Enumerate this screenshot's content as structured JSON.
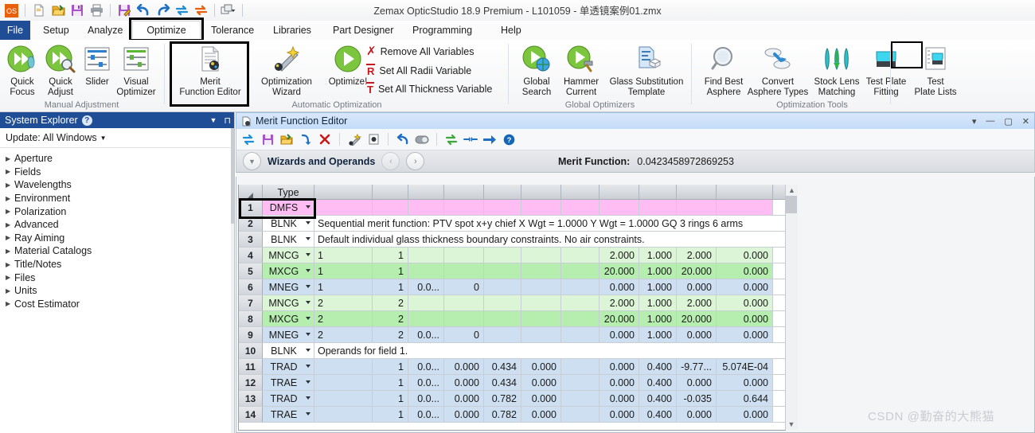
{
  "titlebar": {
    "app_title": "Zemax OpticStudio 18.9     Premium - L101059 - 单透镜案例01.zmx",
    "quick_access": [
      {
        "name": "os-logo-icon",
        "label": "OS"
      },
      {
        "name": "new-file-icon",
        "label": "New"
      },
      {
        "name": "open-file-icon",
        "label": "Open"
      },
      {
        "name": "save-icon",
        "label": "Save"
      },
      {
        "name": "print-icon",
        "label": "Print"
      },
      {
        "name": "save-as-icon",
        "label": "Save As"
      },
      {
        "name": "undo-icon",
        "label": "Undo"
      },
      {
        "name": "redo-icon",
        "label": "Redo"
      },
      {
        "name": "update-icon",
        "label": "Update"
      },
      {
        "name": "update-all-icon",
        "label": "Update All"
      },
      {
        "name": "window-arrange-icon",
        "label": "Windows"
      }
    ]
  },
  "menubar": {
    "items": [
      {
        "label": "File",
        "active": false,
        "highlighted": false
      },
      {
        "label": "Setup",
        "active": false,
        "highlighted": false
      },
      {
        "label": "Analyze",
        "active": false,
        "highlighted": false
      },
      {
        "label": "Optimize",
        "active": true,
        "highlighted": true
      },
      {
        "label": "Tolerance",
        "active": false,
        "highlighted": false
      },
      {
        "label": "Libraries",
        "active": false,
        "highlighted": false
      },
      {
        "label": "Part Designer",
        "active": false,
        "highlighted": false
      },
      {
        "label": "Programming",
        "active": false,
        "highlighted": false
      },
      {
        "label": "Help",
        "active": false,
        "highlighted": false
      }
    ]
  },
  "ribbon": {
    "groups": [
      {
        "caption": "Manual Adjustment"
      },
      {
        "caption": "Automatic Optimization"
      },
      {
        "caption": "Global Optimizers"
      },
      {
        "caption": "Optimization Tools"
      }
    ],
    "buttons": {
      "quick_focus": "Quick\nFocus",
      "quick_focus_l1": "Quick",
      "quick_focus_l2": "Focus",
      "quick_adjust_l1": "Quick",
      "quick_adjust_l2": "Adjust",
      "slider": "Slider",
      "visual_opt_l1": "Visual",
      "visual_opt_l2": "Optimizer",
      "merit_fn_l1": "Merit",
      "merit_fn_l2": "Function Editor",
      "opt_wizard_l1": "Optimization",
      "opt_wizard_l2": "Wizard",
      "optimize": "Optimize!",
      "global_search_l1": "Global",
      "global_search_l2": "Search",
      "hammer_l1": "Hammer",
      "hammer_l2": "Current",
      "glass_sub_l1": "Glass Substitution",
      "glass_sub_l2": "Template",
      "find_best_l1": "Find Best",
      "find_best_l2": "Asphere",
      "convert_l1": "Convert",
      "convert_l2": "Asphere Types",
      "stock_lens_l1": "Stock Lens",
      "stock_lens_l2": "Matching",
      "test_plate_fit_l1": "Test Plate",
      "test_plate_fit_l2": "Fitting",
      "test_plate_lists_l1": "Test",
      "test_plate_lists_l2": "Plate Lists"
    },
    "small_commands": [
      {
        "label": "Remove All Variables",
        "glyph": "X",
        "color": "#c8181c"
      },
      {
        "label": "Set All Radii Variable",
        "glyph": "R",
        "color": "#c8181c"
      },
      {
        "label": "Set All Thickness Variable",
        "glyph": "T",
        "color": "#c8181c"
      }
    ]
  },
  "system_explorer": {
    "title": "System Explorer",
    "help_icon": "?",
    "update_label": "Update: All Windows",
    "items": [
      {
        "label": "Aperture"
      },
      {
        "label": "Fields"
      },
      {
        "label": "Wavelengths"
      },
      {
        "label": "Environment"
      },
      {
        "label": "Polarization"
      },
      {
        "label": "Advanced"
      },
      {
        "label": "Ray Aiming"
      },
      {
        "label": "Material Catalogs"
      },
      {
        "label": "Title/Notes"
      },
      {
        "label": "Files"
      },
      {
        "label": "Units"
      },
      {
        "label": "Cost Estimator"
      }
    ]
  },
  "mfe": {
    "window_title": "Merit Function Editor",
    "window_controls": [
      "▾",
      "—",
      "▢",
      "✕"
    ],
    "toolbar_icons": [
      {
        "name": "refresh-icon"
      },
      {
        "name": "save-icon"
      },
      {
        "name": "open-icon"
      },
      {
        "name": "insert-icon"
      },
      {
        "name": "delete-icon"
      },
      {
        "name": "wizard-icon"
      },
      {
        "name": "properties-icon"
      },
      {
        "name": "undo-icon"
      },
      {
        "name": "toggle-icon"
      },
      {
        "name": "sync-icon"
      },
      {
        "name": "collapse-icon"
      },
      {
        "name": "next-icon"
      },
      {
        "name": "help-icon"
      }
    ],
    "wizard_bar": {
      "title": "Wizards and Operands",
      "prev": "‹",
      "next": "›",
      "merit_label": "Merit Function:",
      "merit_value": "0.0423458972869253"
    },
    "grid": {
      "header_type": "Type",
      "columns": [
        "",
        "Type",
        "",
        "",
        "",
        "",
        "",
        "",
        "",
        "",
        "",
        "",
        "",
        ""
      ],
      "rows": [
        {
          "n": "1",
          "type": "DMFS",
          "color": "pink",
          "selected": true,
          "comment": "",
          "cells": []
        },
        {
          "n": "2",
          "type": "BLNK",
          "color": "white",
          "comment": "Sequential merit function: PTV spot x+y chief X Wgt = 1.0000 Y Wgt = 1.0000 GQ 3 rings 6 arms",
          "cells": []
        },
        {
          "n": "3",
          "type": "BLNK",
          "color": "white",
          "comment": "Default individual glass thickness boundary constraints. No air constraints.",
          "cells": []
        },
        {
          "n": "4",
          "type": "MNCG",
          "color": "green-light",
          "comment": "",
          "cells": [
            "1",
            "1",
            "",
            "",
            "",
            "",
            "",
            "2.000",
            "1.000",
            "2.000",
            "0.000"
          ]
        },
        {
          "n": "5",
          "type": "MXCG",
          "color": "green",
          "comment": "",
          "cells": [
            "1",
            "1",
            "",
            "",
            "",
            "",
            "",
            "20.000",
            "1.000",
            "20.000",
            "0.000"
          ]
        },
        {
          "n": "6",
          "type": "MNEG",
          "color": "blue",
          "comment": "",
          "cells": [
            "1",
            "1",
            "0.0...",
            "0",
            "",
            "",
            "",
            "0.000",
            "1.000",
            "0.000",
            "0.000"
          ]
        },
        {
          "n": "7",
          "type": "MNCG",
          "color": "green-light",
          "comment": "",
          "cells": [
            "2",
            "2",
            "",
            "",
            "",
            "",
            "",
            "2.000",
            "1.000",
            "2.000",
            "0.000"
          ]
        },
        {
          "n": "8",
          "type": "MXCG",
          "color": "green",
          "comment": "",
          "cells": [
            "2",
            "2",
            "",
            "",
            "",
            "",
            "",
            "20.000",
            "1.000",
            "20.000",
            "0.000"
          ]
        },
        {
          "n": "9",
          "type": "MNEG",
          "color": "blue",
          "comment": "",
          "cells": [
            "2",
            "2",
            "0.0...",
            "0",
            "",
            "",
            "",
            "0.000",
            "1.000",
            "0.000",
            "0.000"
          ]
        },
        {
          "n": "10",
          "type": "BLNK",
          "color": "white",
          "comment": "Operands for field 1.",
          "cells": []
        },
        {
          "n": "11",
          "type": "TRAD",
          "color": "blue",
          "comment": "",
          "cells": [
            "",
            "1",
            "0.0...",
            "0.000",
            "0.434",
            "0.000",
            "",
            "0.000",
            "0.400",
            "-9.77...",
            "5.074E-04"
          ]
        },
        {
          "n": "12",
          "type": "TRAE",
          "color": "blue",
          "comment": "",
          "cells": [
            "",
            "1",
            "0.0...",
            "0.000",
            "0.434",
            "0.000",
            "",
            "0.000",
            "0.400",
            "0.000",
            "0.000"
          ]
        },
        {
          "n": "13",
          "type": "TRAD",
          "color": "blue",
          "comment": "",
          "cells": [
            "",
            "1",
            "0.0...",
            "0.000",
            "0.782",
            "0.000",
            "",
            "0.000",
            "0.400",
            "-0.035",
            "0.644"
          ]
        },
        {
          "n": "14",
          "type": "TRAE",
          "color": "blue",
          "comment": "",
          "cells": [
            "",
            "1",
            "0.0...",
            "0.000",
            "0.782",
            "0.000",
            "",
            "0.000",
            "0.400",
            "0.000",
            "0.000"
          ]
        }
      ]
    }
  },
  "watermark": "CSDN @勤奋的大熊猫"
}
